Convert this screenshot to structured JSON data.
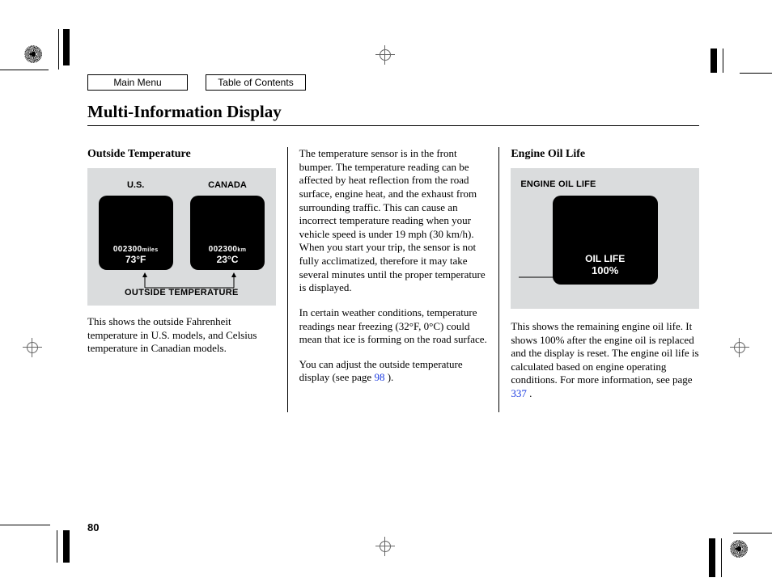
{
  "nav": {
    "main_menu": "Main Menu",
    "toc": "Table of Contents"
  },
  "title": "Multi-Information Display",
  "page_number": "80",
  "col1": {
    "heading": "Outside Temperature",
    "fig": {
      "label_us": "U.S.",
      "label_ca": "CANADA",
      "odo_us": "002300",
      "odo_us_unit": "miles",
      "temp_us": "73°F",
      "odo_ca": "002300",
      "odo_ca_unit": "km",
      "temp_ca": "23°C",
      "caption": "OUTSIDE TEMPERATURE"
    },
    "p1": "This shows the outside Fahrenheit temperature in U.S. models, and Celsius temperature in Canadian models."
  },
  "col2": {
    "p1": "The temperature sensor is in the front bumper. The temperature reading can be affected by heat reflection from the road surface, engine heat, and the exhaust from surrounding traffic. This can cause an incorrect temperature reading when your vehicle speed is under 19 mph (30 km/h). When you start your trip, the sensor is not fully acclimatized, therefore it may take several minutes until the proper temperature is displayed.",
    "p2": "In certain weather conditions, temperature readings near freezing (32°F, 0°C) could mean that ice is forming on the road surface.",
    "p3a": "You can adjust the outside temperature display (see page ",
    "p3_link": "98",
    "p3b": " )."
  },
  "col3": {
    "heading": "Engine Oil Life",
    "fig": {
      "title": "ENGINE OIL LIFE",
      "oil_label": "OIL LIFE",
      "oil_value": "100%"
    },
    "p1a": "This shows the remaining engine oil life. It shows 100% after the engine oil is replaced and the display is reset. The engine oil life is calculated based on engine operating conditions. For more information, see page ",
    "p1_link": "337",
    "p1b": " ."
  }
}
